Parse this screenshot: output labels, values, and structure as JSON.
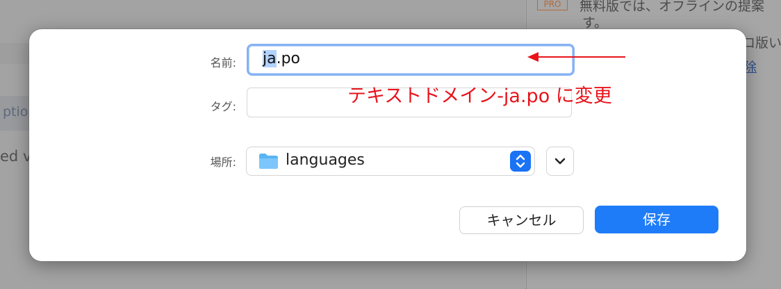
{
  "background": {
    "left_partial_tab": "ptio",
    "left_partial_text": "ed v",
    "right_badge": "PRO",
    "right_line1": "無料版では、オフラインの提案",
    "right_line2": "す。",
    "right_line3": "ロ版い",
    "right_link": "除"
  },
  "dialog": {
    "name_label": "名前:",
    "name_value_selected": "ja",
    "name_value_rest": ".po",
    "tag_label": "タグ:",
    "tag_value": "",
    "place_label": "場所:",
    "place_value": "languages",
    "cancel_label": "キャンセル",
    "save_label": "保存"
  },
  "annotation": {
    "text": "テキストドメイン-ja.po に変更",
    "color": "#e8131b"
  },
  "colors": {
    "accent": "#1f7cf8",
    "focus_ring": "#86b2f3"
  },
  "icons": {
    "place": "folder-icon",
    "stepper": "up-down-chevron-icon",
    "expand": "chevron-down-icon"
  }
}
